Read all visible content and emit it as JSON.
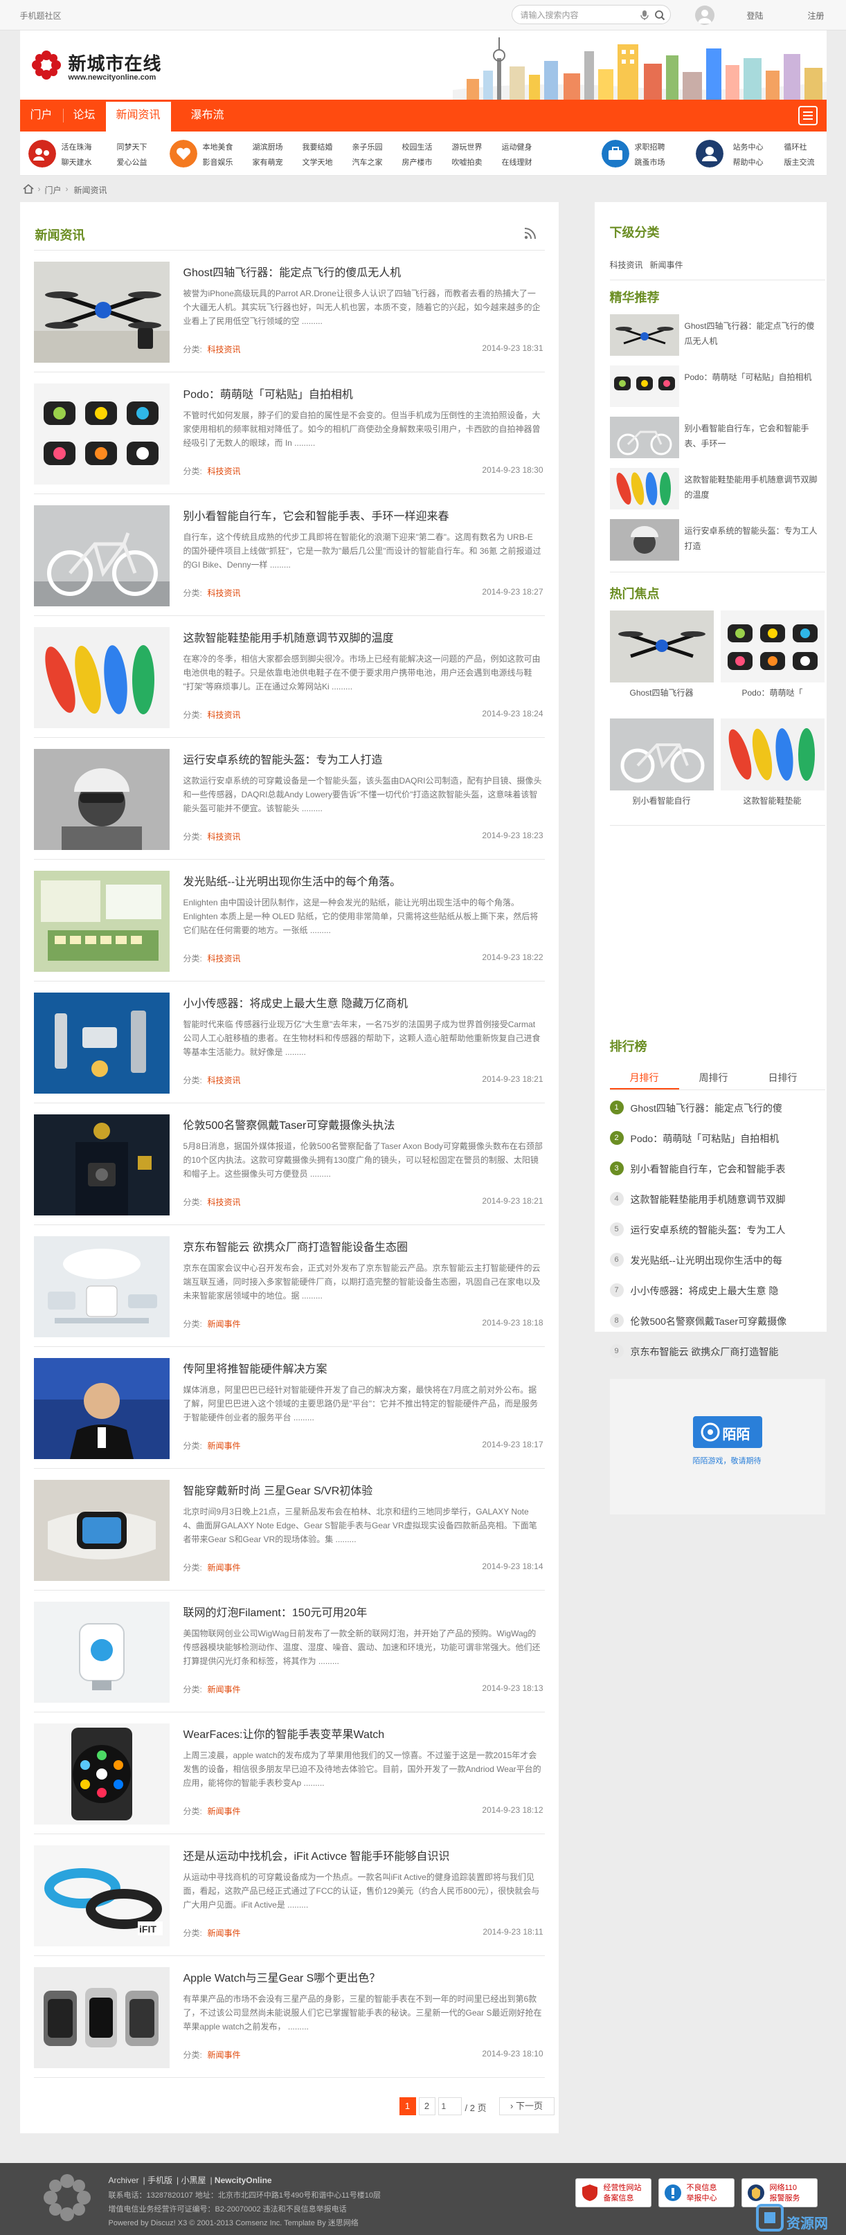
{
  "topbar": {
    "mobile_label": "手机题社区",
    "search_placeholder": "请输入搜索内容",
    "login": "登陆",
    "register": "注册"
  },
  "header": {
    "logo_title": "新城市在线",
    "logo_url": "www.newcityonline.com"
  },
  "nav": {
    "items": [
      "门户",
      "论坛",
      "新闻资讯",
      "瀑布流"
    ],
    "active": "新闻资讯"
  },
  "subnav": {
    "groups": [
      [
        "活在珠海",
        "聊天建水"
      ],
      [
        "同梦天下",
        "爱心公益"
      ],
      [
        "本地美食",
        "影音娱乐"
      ],
      [
        "湖滨厨场",
        "家有萌宠"
      ],
      [
        "我要结婚",
        "文学天地"
      ],
      [
        "亲子乐园",
        "汽车之家"
      ],
      [
        "校园生活",
        "房产楼市"
      ],
      [
        "游玩世界",
        "吹嘘拍卖"
      ],
      [
        "运动健身",
        "在线理财"
      ],
      [
        "求职招聘",
        "跳蚤市场"
      ],
      [
        "站务中心",
        "帮助中心"
      ],
      [
        "循环社",
        "版主交流"
      ]
    ]
  },
  "breadcrumb": {
    "items": [
      "门户",
      "新闻资讯"
    ]
  },
  "main": {
    "title": "新闻资讯",
    "category_prefix": "分类:",
    "articles": [
      {
        "title": "Ghost四轴飞行器：能定点飞行的傻瓜无人机",
        "summary": "被誉为iPhone高级玩具的Parrot AR.Drone让很多人认识了四轴飞行器，而教者去看的热捕大了一个大疆无人机。其实玩飞行器也好，叫无人机也罢，本质不变，随着它的兴起，如今越来越多的企业看上了民用低空飞行领域的空 .........",
        "category": "科技资讯",
        "date": "2014-9-23 18:31"
      },
      {
        "title": "Podo：萌萌哒「可粘贴」自拍相机",
        "summary": "不管时代如何发展，脖子们的爱自拍的属性是不会变的。但当手机成为压倒性的主流拍照设备，大家使用相机的频率就相对降低了。如今的相机厂商使劲全身解数来吸引用户，卡西欧的自拍神器曾经吸引了无数人的眼球，而 In .........",
        "category": "科技资讯",
        "date": "2014-9-23 18:30"
      },
      {
        "title": "别小看智能自行车，它会和智能手表、手环一样迎来春",
        "summary": "自行车，这个传统且成熟的代步工具即将在智能化的浪潮下迎来\"第二春\"。这周有数名为 URB-E 的国外硬件项目上线做\"抓狂\"，它是一款为\"最后几公里\"而设计的智能自行车。和 36氪 之前报道过的GI Bike、Denny一样 .........",
        "category": "科技资讯",
        "date": "2014-9-23 18:27"
      },
      {
        "title": "这款智能鞋垫能用手机随意调节双脚的温度",
        "summary": "在寒冷的冬季，相信大家都会感到脚尖很冷。市场上已经有能解决这一问题的产品，例如这款可由电池供电的鞋子。只是依靠电池供电鞋子在不便于要求用户携带电池，用户还会遇到电源线与鞋 \"打架\"等麻烦事儿。正在通过众筹网站Ki .........",
        "category": "科技资讯",
        "date": "2014-9-23 18:24"
      },
      {
        "title": "运行安卓系统的智能头盔：专为工人打造",
        "summary": "这款运行安卓系统的可穿戴设备是一个智能头盔，该头盔由DAQRI公司制造，配有护目镜、摄像头和一些传感器，DAQRI总裁Andy Lowery要告诉\"不懂一切代价\"打造这款智能头盔，这意味着该智能头盔可能并不便宜。该智能头 .........",
        "category": "科技资讯",
        "date": "2014-9-23 18:23"
      },
      {
        "title": "发光贴纸--让光明出现你生活中的每个角落。",
        "summary": "Enlighten 由中国设计团队制作，这是一种会发光的贴纸，能让光明出现生活中的每个角落。Enlighten 本质上是一种 OLED 贴纸，它的使用非常简单，只需将这些贴纸从板上撕下来，然后将它们贴在任何需要的地方。一张纸 .........",
        "category": "科技资讯",
        "date": "2014-9-23 18:22"
      },
      {
        "title": "小小传感器：将成史上最大生意 隐藏万亿商机",
        "summary": "智能时代来临 传感器行业现万亿\"大生意\"去年末，一名75岁的法国男子成为世界首例接受Carmat公司人工心脏移植的患者。在生物材料和传感器的帮助下，这颗人造心脏帮助他重新恢复自己进食等基本生活能力。就好像是 .........",
        "category": "科技资讯",
        "date": "2014-9-23 18:21"
      },
      {
        "title": "伦敦500名警察佩戴Taser可穿戴摄像头执法",
        "summary": "5月8日消息，据国外媒体报道，伦敦500名警察配备了Taser Axon Body可穿戴摄像头数布在右颈部的10个区内执法。这款可穿戴摄像头拥有130度广角的镜头，可以轻松固定在警员的制服、太阳镜和帽子上。这些摄像头可方便登员 .........",
        "category": "科技资讯",
        "date": "2014-9-23 18:21"
      },
      {
        "title": "京东布智能云 欲携众厂商打造智能设备生态圈",
        "summary": "京东在国家会议中心召开发布会，正式对外发布了京东智能云产品。京东智能云主打智能硬件的云端互联互通，同时接入多家智能硬件厂商，以期打造完整的智能设备生态圈，巩固自己在家电以及未来智能家居领域中的地位。据 .........",
        "category": "新闻事件",
        "date": "2014-9-23 18:18"
      },
      {
        "title": "传阿里将推智能硬件解决方案",
        "summary": "媒体消息，阿里巴巴已经针对智能硬件开发了自己的解决方案，最快将在7月底之前对外公布。据了解，阿里巴巴进入这个领域的主要思路仍是\"平台\"：它并不推出特定的智能硬件产品，而是服务于智能硬件创业者的服务平台 .........",
        "category": "新闻事件",
        "date": "2014-9-23 18:17"
      },
      {
        "title": "智能穿戴新时尚 三星Gear S/VR初体验",
        "summary": "北京时间9月3日晚上21点，三星新品发布会在柏林、北京和纽约三地同步举行，GALAXY Note 4、曲面屏GALAXY Note Edge、Gear S智能手表与Gear VR虚拟现实设备四款新品亮相。下面笔者带来Gear S和Gear VR的现场体验。集 .........",
        "category": "新闻事件",
        "date": "2014-9-23 18:14"
      },
      {
        "title": "联网的灯泡Filament：150元可用20年",
        "summary": "美国物联网创业公司WigWag日前发布了一款全新的联网灯泡，并开始了产品的预购。WigWag的传感器模块能够检测动作、温度、湿度、噪音、震动、加速和环境光，功能可谓非常强大。他们还打算提供闪光灯条和标签，将其作为 .........",
        "category": "新闻事件",
        "date": "2014-9-23 18:13"
      },
      {
        "title": "WearFaces:让你的智能手表变苹果Watch",
        "summary": "上周三凌晨，apple watch的发布成为了苹果用他我们的又一惊喜。不过鉴于这是一款2015年才会发售的设备，相信很多朋友早已迫不及待地去体验它。目前，国外开发了一款Andriod Wear平台的应用，能将你的智能手表秒变Ap .........",
        "category": "新闻事件",
        "date": "2014-9-23 18:12"
      },
      {
        "title": "还是从运动中找机会，iFit Activce 智能手环能够自识识",
        "summary": "从运动中寻找商机的可穿戴设备成为一个热点。一款名叫iFit Active的健身追踪装置即将与我们见面，看起，这款产品已经正式通过了FCC的认证，售价129美元（约合人民币800元），很快就会与广大用户见面。iFit Active是 .........",
        "category": "新闻事件",
        "date": "2014-9-23 18:11"
      },
      {
        "title": "Apple Watch与三星Gear S哪个更出色？",
        "summary": "有苹果产品的市场不会没有三星产品的身影，三星的智能手表在不到一年的时间里已经出到第6款了，不过该公司显然尚未能说服人们它已掌握智能手表的秘诀。三星新一代的Gear S最近刚好抢在苹果apple watch之前发布， .........",
        "category": "新闻事件",
        "date": "2014-9-23 18:10"
      }
    ],
    "pager": {
      "pages": [
        "1",
        "2"
      ],
      "current": "1",
      "input_value": "1",
      "total": "/ 2 页",
      "next": "下一页"
    }
  },
  "sidebar": {
    "sub_title": "下级分类",
    "sub_categories": [
      "科技资讯",
      "新闻事件"
    ],
    "picks_title": "精华推荐",
    "picks": [
      "Ghost四轴飞行器：能定点飞行的傻瓜无人机",
      "Podo：萌萌哒「可粘贴」自拍相机",
      "别小看智能自行车，它会和智能手表、手环一",
      "这款智能鞋垫能用手机随意调节双脚的温度",
      "运行安卓系统的智能头盔：专为工人打造"
    ],
    "hot_title": "热门焦点",
    "hot": [
      "Ghost四轴飞行器",
      "Podo：萌萌哒「",
      "别小看智能自行",
      "这款智能鞋垫能"
    ],
    "rank_title": "排行榜",
    "rank_tabs": [
      "月排行",
      "周排行",
      "日排行"
    ],
    "rank_active": "月排行",
    "rank_items": [
      "Ghost四轴飞行器：能定点飞行的傻",
      "Podo：萌萌哒「可粘贴」自拍相机",
      "别小看智能自行车，它会和智能手表",
      "这款智能鞋垫能用手机随意调节双脚",
      "运行安卓系统的智能头盔：专为工人",
      "发光贴纸--让光明出现你生活中的每",
      "小小传感器：将成史上最大生意 隐",
      "伦敦500名警察佩戴Taser可穿戴摄像",
      "京东布智能云 欲携众厂商打造智能"
    ],
    "ad": {
      "brand": "陌陌",
      "link": "陌陌游戏，敬请期待"
    }
  },
  "footer": {
    "links": [
      "Archiver",
      "手机版",
      "小黑屋",
      "NewcityOnline"
    ],
    "line1": "联系电话：13287820107 地址：北京市北四环中路1号490号和谐中心11号楼10层",
    "line2": "增值电信业务经营许可证编号：B2-20070002 违法和不良信息举报电话",
    "line3": "Powered by Discuz! X3 © 2001-2013 Comsenz Inc. Template By 迷思网络",
    "badges": [
      {
        "line1": "经营性网站",
        "line2": "备案信息"
      },
      {
        "line1": "不良信息",
        "line2": "举报中心"
      },
      {
        "line1": "网络110",
        "line2": "报警服务"
      }
    ],
    "watermark": "资源网"
  },
  "colors": {
    "accent": "#ff4b10",
    "section_title": "#6b8e23",
    "category_link": "#e0490b",
    "footer_bg": "#4a4a4a"
  }
}
